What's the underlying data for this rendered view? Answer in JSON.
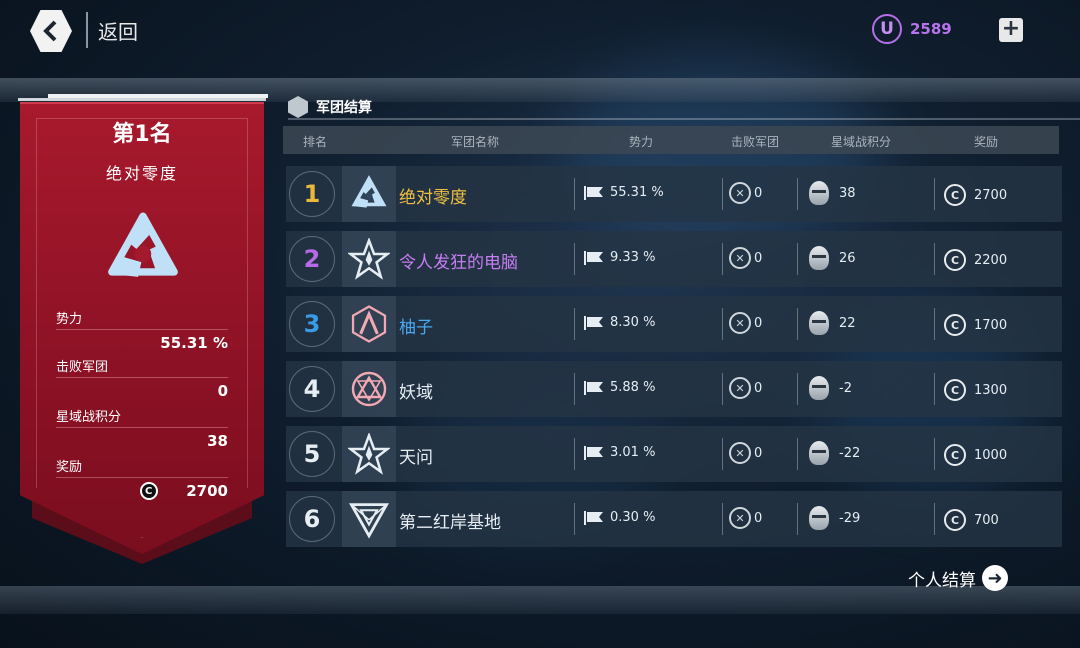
{
  "topbar": {
    "back_label": "返回",
    "currency_symbol": "U",
    "currency_value": "2589",
    "add_symbol": "+"
  },
  "banner": {
    "rank_title": "第1名",
    "team_name": "绝对零度",
    "stats": [
      {
        "label": "势力",
        "value": "55.31 %"
      },
      {
        "label": "击败军团",
        "value": "0"
      },
      {
        "label": "星域战积分",
        "value": "38"
      },
      {
        "label": "奖励",
        "value": "2700"
      }
    ]
  },
  "section": {
    "title": "军团结算"
  },
  "table": {
    "headers": [
      "排名",
      "军团名称",
      "势力",
      "击败军团",
      "星域战积分",
      "奖励"
    ],
    "rows": [
      {
        "rank": "1",
        "name": "绝对零度",
        "power": "55.31 %",
        "defeated": "0",
        "score": "38",
        "reward": "2700"
      },
      {
        "rank": "2",
        "name": "令人发狂的电脑",
        "power": "9.33 %",
        "defeated": "0",
        "score": "26",
        "reward": "2200"
      },
      {
        "rank": "3",
        "name": "柚子",
        "power": "8.30 %",
        "defeated": "0",
        "score": "22",
        "reward": "1700"
      },
      {
        "rank": "4",
        "name": "妖域",
        "power": "5.88 %",
        "defeated": "0",
        "score": "-2",
        "reward": "1300"
      },
      {
        "rank": "5",
        "name": "天问",
        "power": "3.01 %",
        "defeated": "0",
        "score": "-22",
        "reward": "1000"
      },
      {
        "rank": "6",
        "name": "第二红岸基地",
        "power": "0.30 %",
        "defeated": "0",
        "score": "-29",
        "reward": "700"
      }
    ]
  },
  "colors": {
    "rank1": "#e9b93b",
    "rank2": "#b66ae6",
    "rank3": "#3b9be6",
    "rank_default": "#e6edf3",
    "name1": "#f0c040",
    "name2": "#c77df2",
    "name3": "#4aa8f0",
    "name_default": "#e6edf3"
  },
  "icons": {
    "back": "chevron-left-icon",
    "coin": "c-coin-icon",
    "power": "flag-icon",
    "defeat": "crossed-swords-icon",
    "score": "helmet-icon",
    "personal": "arrow-right-icon"
  },
  "personal_settlement": "个人结算"
}
